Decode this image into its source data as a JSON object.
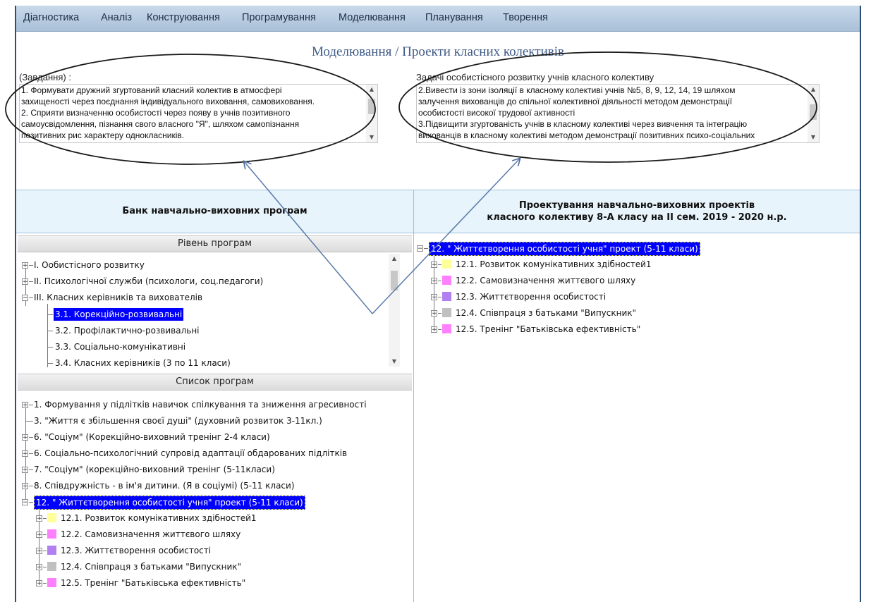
{
  "menu": [
    "Діагностика",
    "Аналіз",
    "Конструювання",
    "Програмування",
    "Моделювання",
    "Планування",
    "Творення"
  ],
  "page_title": "Моделювання / Проекти класних колективів",
  "left_task": {
    "label": "(Завдання) :",
    "lines": [
      "1. Формувати дружний згуртований класний колектив в атмосфері",
      "захищеності через поєднання індивідуального виховання, самовиховання.",
      "2. Сприяти  визначенню особистості через появу  в учнів позитивного",
      "самоусвідомлення,  пізнання  свого власного  \"Я\", шляхом самопізнання",
      "позитивних рис характеру однокласників."
    ]
  },
  "right_task": {
    "label": "Задачі особистісного розвитку учнів класного колективу",
    "lines": [
      "2.Вивести із зони ізоляції в класному колективі учнів №5, 8, 9, 12, 14, 19 шляхом",
      "залучення вихованців до спільної колективної діяльності методом демонстрації",
      "особистості високої трудової активності",
      "3.Підвищити згуртованість учнів в класному колективі через вивчення та інтеграцію",
      "вихованців в класному колективі методом демонстрації позитивних психо-соціальних"
    ]
  },
  "left_header": "Банк навчально-виховних програм",
  "right_header": {
    "line1": "Проектування навчально-виховних проектів",
    "line2": "класного колективу 8-А класу на II сем. 2019 - 2020 н.р."
  },
  "levels": {
    "title": "Рівень програм",
    "items": [
      "I. Ообистісного розвитку",
      "II. Психологічної служби (психологи, соц.педагоги)",
      "III. Класних керівників та вихователів",
      "3.1. Корекційно-розвивальні",
      "3.2. Профілактично-розвивальні",
      "3.3. Соціально-комунікативні",
      "3.4. Класних керівників (3 по 11 класи)"
    ]
  },
  "programs": {
    "title": "Список програм",
    "items": [
      "1. Формування у підлітків навичок спілкування та зниження  агресивності",
      "3. \"Життя є збільшення своєї душі\" (духовний розвиток 3-11кл.)",
      "6. \"Соціум\" (Корекційно-виховний тренінг 2-4 класи)",
      "6.  Соціально-психологічний супровід адаптації обдарованих підлітків",
      "7. \"Соціум\" (корекційно-виховний тренінг (5-11класи)",
      "8. Співдружність - в ім'я дитини. (Я в соціумі) (5-11 класи)",
      "12. \" Життєтворення особистості учня\" проект (5-11 класи)"
    ]
  },
  "project": {
    "title": "12. \" Життєтворення особистості учня\" проект (5-11 класи)",
    "children": [
      {
        "label": "12.1. Розвиток комунікативних здібностей1",
        "color": "#ffff99"
      },
      {
        "label": "12.2. Самовизначення життєвого шляху",
        "color": "#ff80ff"
      },
      {
        "label": "12.3. Життєтворення особистості",
        "color": "#b07ff0"
      },
      {
        "label": "12.4. Співпраця з батьками \"Випускник\"",
        "color": "#c0c0c0"
      },
      {
        "label": "12.5. Тренінг \"Батьківська ефективність\"",
        "color": "#ff80ff"
      }
    ]
  }
}
